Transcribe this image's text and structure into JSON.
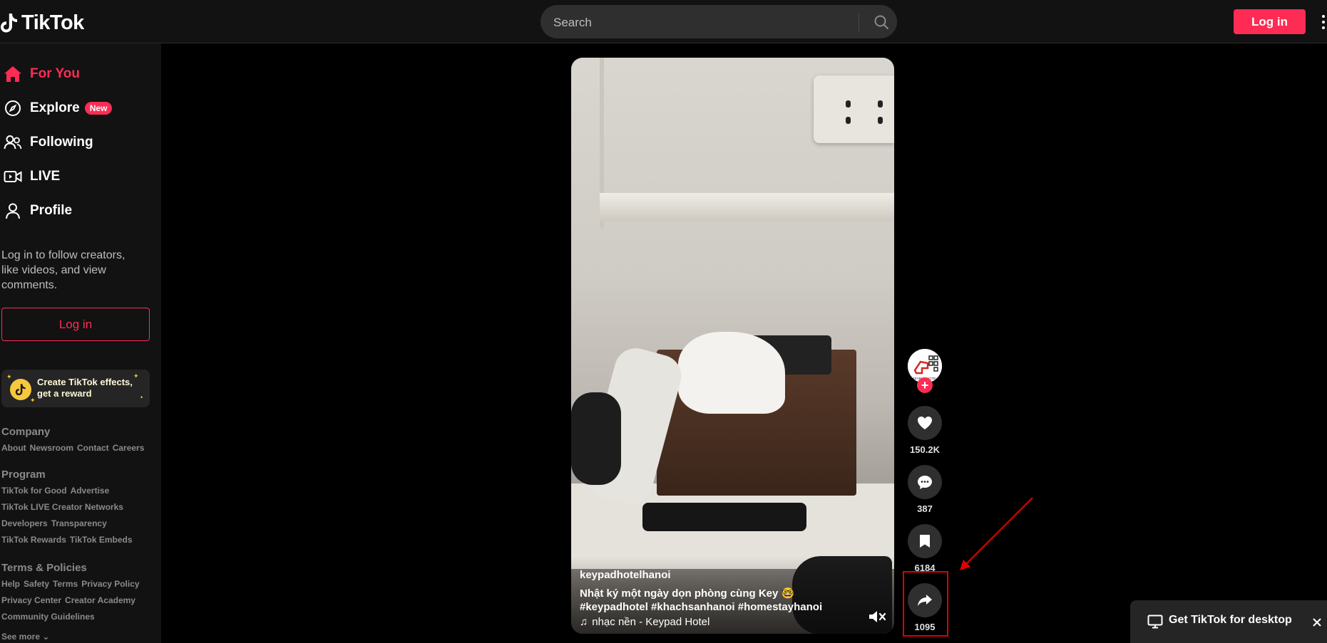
{
  "header": {
    "logo_text": "TikTok",
    "search_placeholder": "Search",
    "login_label": "Log in"
  },
  "sidebar": {
    "nav": [
      {
        "label": "For You",
        "icon": "home-icon",
        "active": true
      },
      {
        "label": "Explore",
        "icon": "compass-icon",
        "badge": "New"
      },
      {
        "label": "Following",
        "icon": "users-icon"
      },
      {
        "label": "LIVE",
        "icon": "live-camera-icon"
      },
      {
        "label": "Profile",
        "icon": "person-icon"
      }
    ],
    "login_prompt": "Log in to follow creators, like videos, and view comments.",
    "login_button": "Log in",
    "effects_promo": "Create TikTok effects, get a reward",
    "footer": {
      "company_heading": "Company",
      "company_links": [
        "About",
        "Newsroom",
        "Contact",
        "Careers"
      ],
      "program_heading": "Program",
      "program_links_1": [
        "TikTok for Good",
        "Advertise"
      ],
      "program_links_2": [
        "TikTok LIVE Creator Networks"
      ],
      "program_links_3": [
        "Developers",
        "Transparency"
      ],
      "program_links_4": [
        "TikTok Rewards",
        "TikTok Embeds"
      ],
      "terms_heading": "Terms & Policies",
      "terms_links_1": [
        "Help",
        "Safety",
        "Terms",
        "Privacy Policy"
      ],
      "terms_links_2": [
        "Privacy Center",
        "Creator Academy"
      ],
      "terms_links_3": [
        "Community Guidelines"
      ],
      "see_more": "See more"
    }
  },
  "video": {
    "username": "keypadhotelhanoi",
    "description": "Nhật ký một ngày dọn phòng cùng Key 🤓#keypadhotel #khachsanhanoi  #homestayhanoi",
    "music": "nhạc nền - Keypad Hotel"
  },
  "actions": {
    "avatar_label": "KEYPAD HOTEL",
    "likes": "150.2K",
    "comments": "387",
    "saves": "6184",
    "shares": "1095"
  },
  "desktop_banner": {
    "label": "Get TikTok for desktop"
  },
  "colors": {
    "brand": "#fe2c55",
    "background": "#000000",
    "sidebar": "#121212",
    "annotation": "#e00000"
  }
}
